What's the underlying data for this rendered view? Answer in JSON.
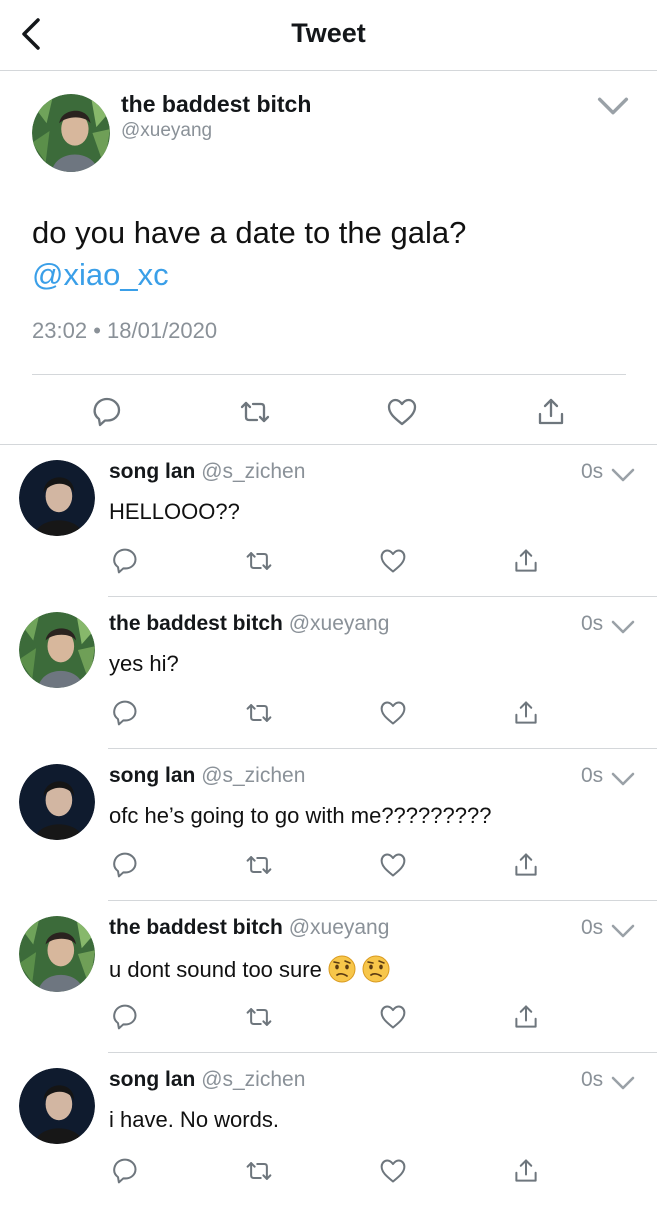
{
  "header": {
    "title": "Tweet",
    "back_icon": "chevron-left-icon"
  },
  "main_tweet": {
    "author_name": "the baddest bitch",
    "author_handle": "@xueyang",
    "text": "do you have a date to the gala?",
    "mention": "@xiao_xc",
    "time": "23:02",
    "separator": "•",
    "date": "18/01/2020",
    "actions": [
      "reply-icon",
      "retweet-icon",
      "like-icon",
      "share-icon"
    ]
  },
  "replies": [
    {
      "name": "song lan",
      "handle": "@s_zichen",
      "time": "0s",
      "text": "HELLOOO??"
    },
    {
      "name": "the baddest bitch",
      "handle": "@xueyang",
      "time": "0s",
      "text": "yes hi?"
    },
    {
      "name": "song lan",
      "handle": "@s_zichen",
      "time": "0s",
      "text": "ofc he’s going to go with me?????????"
    },
    {
      "name": "the baddest bitch",
      "handle": "@xueyang",
      "time": "0s",
      "text": "u dont sound too sure",
      "emojis": [
        "confused-face-emoji",
        "confused-face-emoji"
      ]
    },
    {
      "name": "song lan",
      "handle": "@s_zichen",
      "time": "0s",
      "text": "i have. No words."
    }
  ],
  "colors": {
    "accent": "#3a9fe8",
    "muted": "#8a9198",
    "divider": "#d4d7da",
    "text": "#14171a"
  }
}
